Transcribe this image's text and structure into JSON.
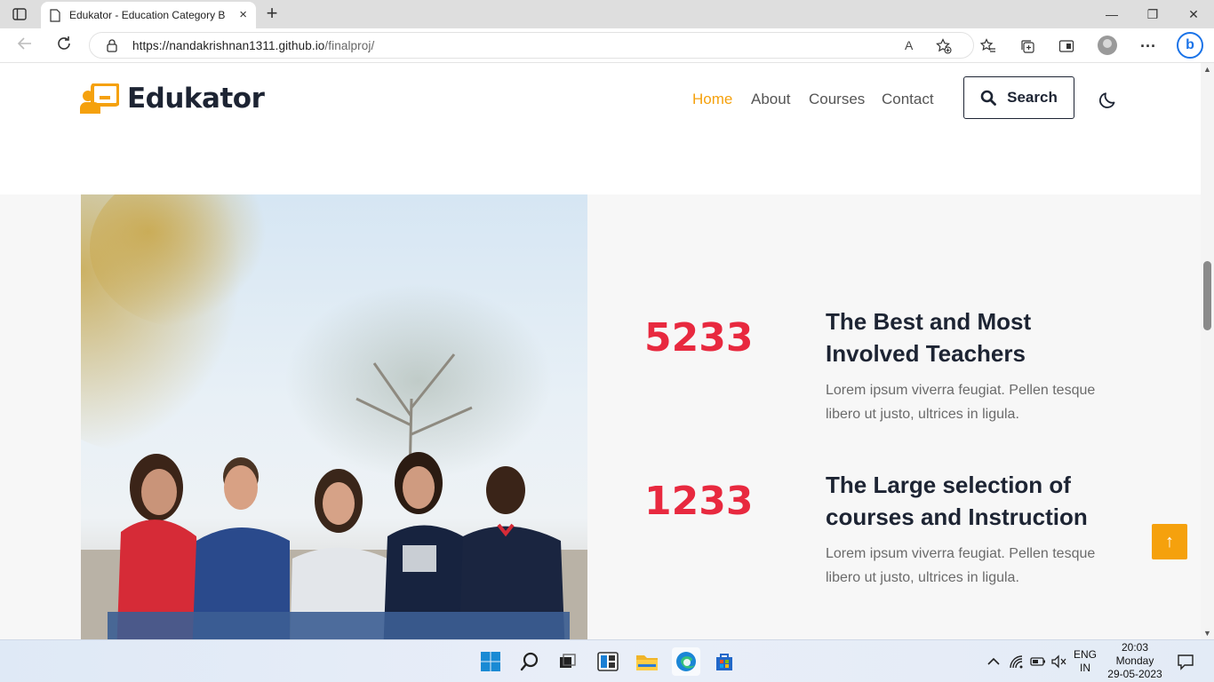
{
  "browser": {
    "tab_title": "Edukator - Education Category B",
    "tab_close": "×",
    "new_tab": "+",
    "url_host": "https://nandakrishnan1311.github.io",
    "url_path": "/finalproj/",
    "read_aloud": "A",
    "minimize": "—",
    "restore": "❐",
    "close": "✕"
  },
  "site": {
    "brand": "Edukator",
    "nav": [
      "Home",
      "About",
      "Courses",
      "Contact"
    ],
    "active_nav": "Home",
    "search_label": "Search",
    "accent_color": "#f5a10d",
    "number_color": "#e8293f"
  },
  "stats": [
    {
      "number": "5233",
      "title": "The Best and Most Involved Teachers",
      "desc": "Lorem ipsum viverra feugiat. Pellen tesque libero ut justo, ultrices in ligula."
    },
    {
      "number": "1233",
      "title": "The Large selection of courses and Instruction",
      "desc": "Lorem ipsum viverra feugiat. Pellen tesque libero ut justo, ultrices in ligula."
    }
  ],
  "back_to_top": "↑",
  "taskbar": {
    "lang_line1": "ENG",
    "lang_line2": "IN",
    "time": "20:03",
    "day": "Monday",
    "date": "29-05-2023"
  }
}
